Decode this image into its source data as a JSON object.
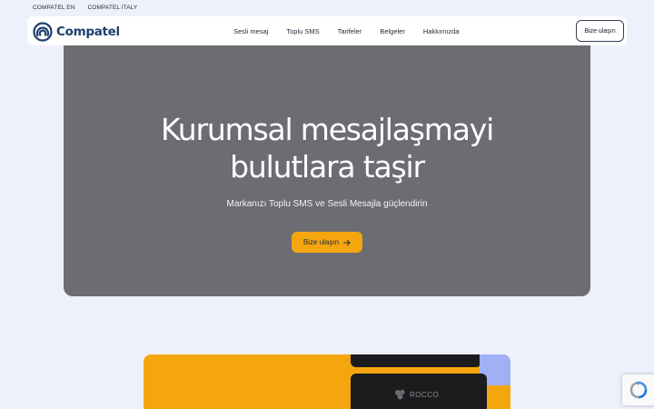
{
  "topbar": {
    "links": [
      "COMPATEL EN",
      "COMPATEL ITALY"
    ]
  },
  "navbar": {
    "logo_text": "Compatel",
    "links": [
      "Sesli mesaj",
      "Toplu SMS",
      "Tarifeler",
      "Belgeler",
      "Hakkımızda"
    ],
    "cta_label": "Bize ulaşın"
  },
  "hero": {
    "title_line1": "Kurumsal mesajlaşmayi",
    "title_line2": "bulutlara taşir",
    "subtitle": "Markanızı Toplu SMS ve Sesli Mesajla güçlendirin",
    "cta_label": "Bize ulaşın",
    "cta_icon": "arrow-right-icon"
  },
  "feature": {
    "brand_text": "ROCCO"
  },
  "colors": {
    "background": "#eef1fb",
    "hero": "#6b6d72",
    "accent": "#f5a60f",
    "brand": "#1d3f6e",
    "periwinkle": "#9fb0f5",
    "dark": "#1c1c1e"
  }
}
